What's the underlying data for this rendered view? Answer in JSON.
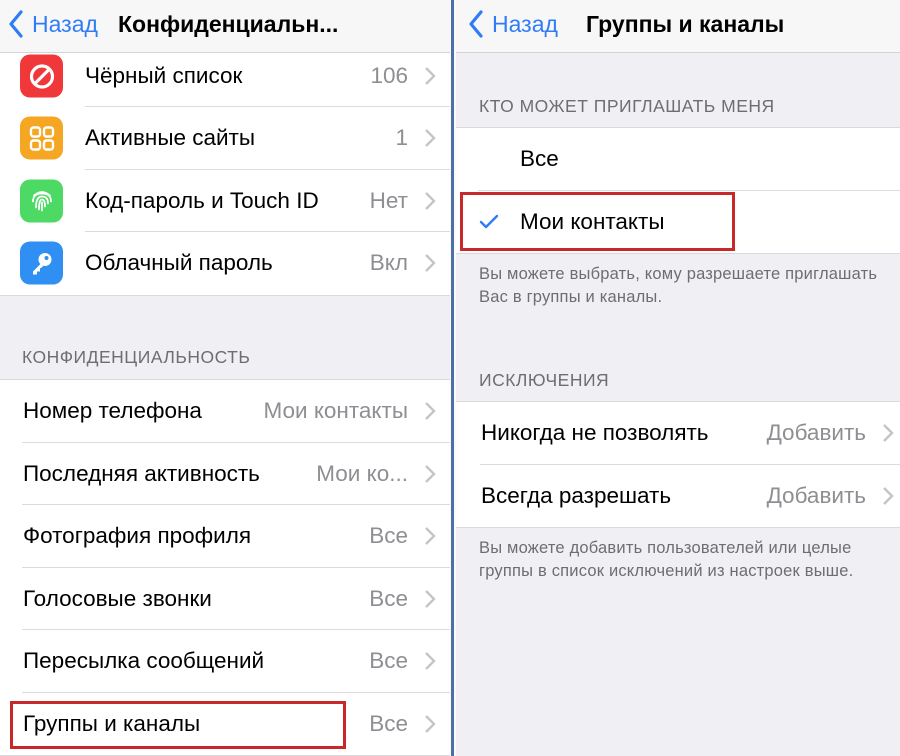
{
  "colors": {
    "accent": "#2f7cf6",
    "highlight": "#c7292b",
    "blacklist_icon": "#f0373a",
    "sites_icon": "#f5a623",
    "passcode_icon": "#4cd964",
    "cloud_icon": "#2f8ff2"
  },
  "left": {
    "nav": {
      "back_label": "Назад",
      "title": "Конфиденциальн..."
    },
    "security_items": [
      {
        "icon": "block-icon",
        "label": "Чёрный список",
        "value": "106"
      },
      {
        "icon": "grid-icon",
        "label": "Активные сайты",
        "value": "1"
      },
      {
        "icon": "fingerprint-icon",
        "label": "Код-пароль и Touch ID",
        "value": "Нет"
      },
      {
        "icon": "key-icon",
        "label": "Облачный пароль",
        "value": "Вкл"
      }
    ],
    "privacy_header": "КОНФИДЕНЦИАЛЬНОСТЬ",
    "privacy_items": [
      {
        "label": "Номер телефона",
        "value": "Мои контакты"
      },
      {
        "label": "Последняя активность",
        "value": "Мои ко..."
      },
      {
        "label": "Фотография профиля",
        "value": "Все"
      },
      {
        "label": "Голосовые звонки",
        "value": "Все"
      },
      {
        "label": "Пересылка сообщений",
        "value": "Все"
      },
      {
        "label": "Группы и каналы",
        "value": "Все"
      }
    ]
  },
  "right": {
    "nav": {
      "back_label": "Назад",
      "title": "Группы и каналы"
    },
    "who_header": "КТО МОЖЕТ ПРИГЛАШАТЬ МЕНЯ",
    "options": [
      {
        "label": "Все",
        "selected": false
      },
      {
        "label": "Мои контакты",
        "selected": true
      }
    ],
    "options_note": "Вы можете выбрать, кому разрешаете приглашать Вас в группы и каналы.",
    "exceptions_header": "ИСКЛЮЧЕНИЯ",
    "exceptions": [
      {
        "label": "Никогда не позволять",
        "value": "Добавить"
      },
      {
        "label": "Всегда разрешать",
        "value": "Добавить"
      }
    ],
    "exceptions_note": "Вы можете добавить пользователей или целые группы в список исключений из настроек выше."
  }
}
